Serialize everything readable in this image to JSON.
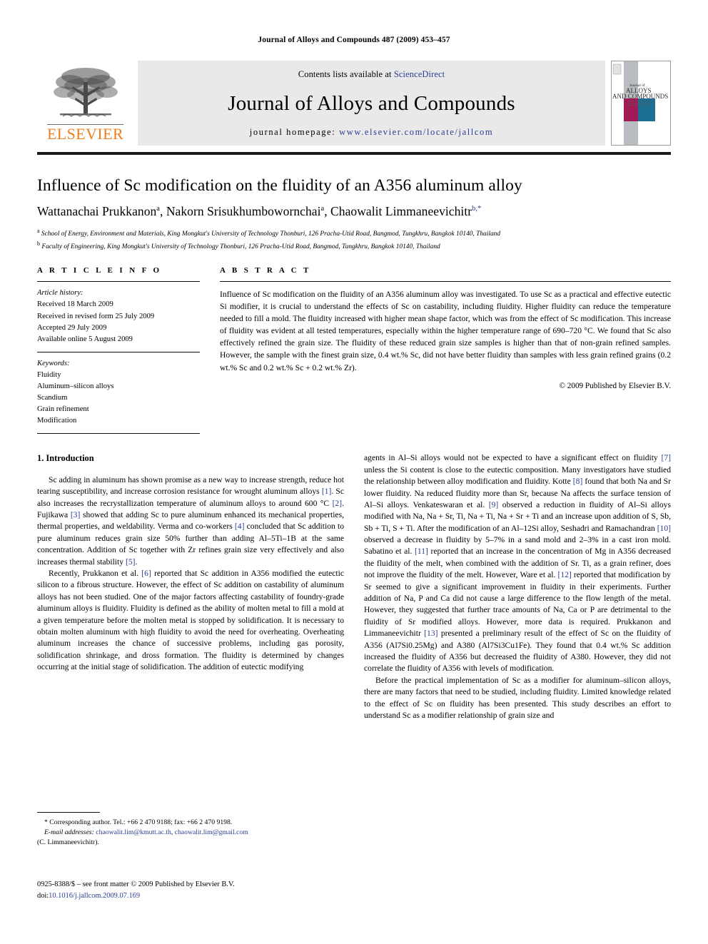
{
  "running_head": "Journal of Alloys and Compounds 487 (2009) 453–457",
  "masthead": {
    "publisher_name": "ELSEVIER",
    "contents_prefix": "Contents lists available at ",
    "sciencedirect": "ScienceDirect",
    "journal_name": "Journal of Alloys and Compounds",
    "homepage_prefix": "journal homepage: ",
    "homepage_url": "www.elsevier.com/locate/jallcom",
    "cover_title_line1": "Journal of",
    "cover_title_line2": "ALLOYS",
    "cover_title_line3": "AND COMPOUNDS",
    "link_color": "#2a3c94",
    "brand_color": "#f07d18"
  },
  "article": {
    "title": "Influence of Sc modification on the fluidity of an A356 aluminum alloy",
    "authors_html": "Wattanachai Prukkanon<sup>a</sup>, Nakorn Srisukhumbowornchai<sup>a</sup>, Chaowalit Limmaneevichitr<sup>b,*</sup>",
    "affiliation_a": "School of Energy, Environment and Materials, King Mongkut's University of Technology Thonburi, 126 Pracha-Utid Road, Bangmod, Tungkhru, Bangkok 10140, Thailand",
    "affiliation_b": "Faculty of Engineering, King Mongkut's University of Technology Thonburi, 126 Pracha-Utid Road, Bangmod, Tungkhru, Bangkok 10140, Thailand"
  },
  "article_info": {
    "label": "A R T I C L E    I N F O",
    "history_header": "Article history:",
    "history": [
      "Received 18 March 2009",
      "Received in revised form 25 July 2009",
      "Accepted 29 July 2009",
      "Available online 5 August 2009"
    ],
    "keywords_header": "Keywords:",
    "keywords": [
      "Fluidity",
      "Aluminum–silicon alloys",
      "Scandium",
      "Grain refinement",
      "Modification"
    ]
  },
  "abstract": {
    "label": "A B S T R A C T",
    "text": "Influence of Sc modification on the fluidity of an A356 aluminum alloy was investigated. To use Sc as a practical and effective eutectic Si modifier, it is crucial to understand the effects of Sc on castability, including fluidity. Higher fluidity can reduce the temperature needed to fill a mold. The fluidity increased with higher mean shape factor, which was from the effect of Sc modification. This increase of fluidity was evident at all tested temperatures, especially within the higher temperature range of 690–720 °C. We found that Sc also effectively refined the grain size. The fluidity of these reduced grain size samples is higher than that of non-grain refined samples. However, the sample with the finest grain size, 0.4 wt.% Sc, did not have better fluidity than samples with less grain refined grains (0.2 wt.% Sc and 0.2 wt.% Sc + 0.2 wt.% Zr).",
    "copyright": "© 2009 Published by Elsevier B.V."
  },
  "body": {
    "section_heading": "1.  Introduction",
    "left_paragraphs": [
      "Sc adding in aluminum has shown promise as a new way to increase strength, reduce hot tearing susceptibility, and increase corrosion resistance for wrought aluminum alloys [1]. Sc also increases the recrystallization temperature of aluminum alloys to around 600 °C [2]. Fujikawa [3] showed that adding Sc to pure aluminum enhanced its mechanical properties, thermal properties, and weldability. Verma and co-workers [4] concluded that Sc addition to pure aluminum reduces grain size 50% further than adding Al–5Ti–1B at the same concentration. Addition of Sc together with Zr refines grain size very effectively and also increases thermal stability [5].",
      "Recently, Prukkanon et al. [6] reported that Sc addition in A356 modified the eutectic silicon to a fibrous structure. However, the effect of Sc addition on castability of aluminum alloys has not been studied. One of the major factors affecting castability of foundry-grade aluminum alloys is fluidity. Fluidity is defined as the ability of molten metal to fill a mold at a given temperature before the molten metal is stopped by solidification. It is necessary to obtain molten aluminum with high fluidity to avoid the need for overheating. Overheating aluminum increases the chance of successive problems, including gas porosity, solidification shrinkage, and dross formation. The fluidity is determined by changes occurring at the initial stage of solidification. The addition of eutectic modifying"
    ],
    "right_paragraphs": [
      "agents in Al–Si alloys would not be expected to have a significant effect on fluidity [7] unless the Si content is close to the eutectic composition. Many investigators have studied the relationship between alloy modification and fluidity. Kotte [8] found that both Na and Sr lower fluidity. Na reduced fluidity more than Sr, because Na affects the surface tension of Al–Si alloys. Venkateswaran et al. [9] observed a reduction in fluidity of Al–Si alloys modified with Na, Na + Sr, Ti, Na + Ti, Na + Sr + Ti and an increase upon addition of S, Sb, Sb + Ti, S + Ti. After the modification of an Al–12Si alloy, Seshadri and Ramachandran [10] observed a decrease in fluidity by 5–7% in a sand mold and 2–3% in a cast iron mold. Sabatino et al. [11] reported that an increase in the concentration of Mg in A356 decreased the fluidity of the melt, when combined with the addition of Sr. Ti, as a grain refiner, does not improve the fluidity of the melt. However, Ware et al. [12] reported that modification by Sr seemed to give a significant improvement in fluidity in their experiments. Further addition of Na, P and Ca did not cause a large difference to the flow length of the metal. However, they suggested that further trace amounts of Na, Ca or P are detrimental to the fluidity of Sr modified alloys. However, more data is required. Prukkanon and Limmaneevichitr [13] presented a preliminary result of the effect of Sc on the fluidity of A356 (Al7Si0.25Mg) and A380 (Al7Si3Cu1Fe). They found that 0.4 wt.% Sc addition increased the fluidity of A356 but decreased the fluidity of A380. However, they did not correlate the fluidity of A356 with levels of modification.",
      "Before the practical implementation of Sc as a modifier for aluminum–silicon alloys, there are many factors that need to be studied, including fluidity. Limited knowledge related to the effect of Sc on fluidity has been presented. This study describes an effort to understand Sc as a modifier relationship of grain size and"
    ]
  },
  "footnotes": {
    "corresponding_marker": "*",
    "corresponding_text": "Corresponding author. Tel.: +66 2 470 9188; fax: +66 2 470 9198.",
    "email_label": "E-mail addresses:",
    "email_1": "chaowalit.lim@kmutt.ac.th",
    "email_separator": ", ",
    "email_2": "chaowalit.lim@gmail.com",
    "email_attribution": "(C. Limmaneevichitr).",
    "issn_line": "0925-8388/$ – see front matter © 2009 Published by Elsevier B.V.",
    "doi_label": "doi:",
    "doi_value": "10.1016/j.jallcom.2009.07.169"
  }
}
